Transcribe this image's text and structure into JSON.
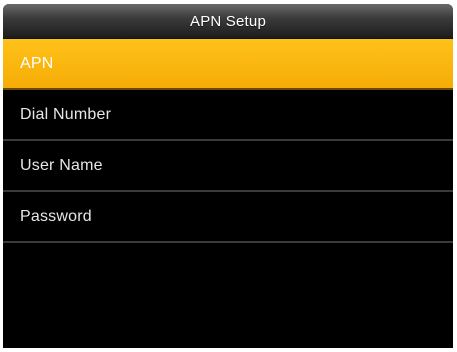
{
  "header": {
    "title": "APN Setup"
  },
  "menu": {
    "items": [
      {
        "label": "APN",
        "selected": true
      },
      {
        "label": "Dial Number",
        "selected": false
      },
      {
        "label": "User Name",
        "selected": false
      },
      {
        "label": "Password",
        "selected": false
      }
    ]
  },
  "colors": {
    "selected_background": "#f8b412",
    "background": "#000000",
    "divider": "#3a3a3a"
  }
}
